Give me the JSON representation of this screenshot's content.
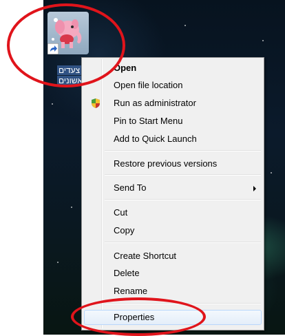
{
  "desktop_icon": {
    "label_line1": "צעדים",
    "label_line2": "ראשונים",
    "image": "elephant-icon",
    "overlay": "shortcut-arrow-icon"
  },
  "context_menu": {
    "items": [
      {
        "label": "Open"
      },
      {
        "label": "Open file location"
      },
      {
        "label": "Run as administrator",
        "icon": "shield-icon"
      },
      {
        "label": "Pin to Start Menu"
      },
      {
        "label": "Add to Quick Launch"
      },
      {
        "label": "Restore previous versions"
      },
      {
        "label": "Send To",
        "icon": "submenu-arrow-icon"
      },
      {
        "label": "Cut"
      },
      {
        "label": "Copy"
      },
      {
        "label": "Create Shortcut"
      },
      {
        "label": "Delete"
      },
      {
        "label": "Rename"
      },
      {
        "label": "Properties"
      }
    ]
  },
  "colors": {
    "annotation": "#e0141b",
    "menu_background": "#f0f0f0",
    "hover_border": "#b8d6fb"
  }
}
